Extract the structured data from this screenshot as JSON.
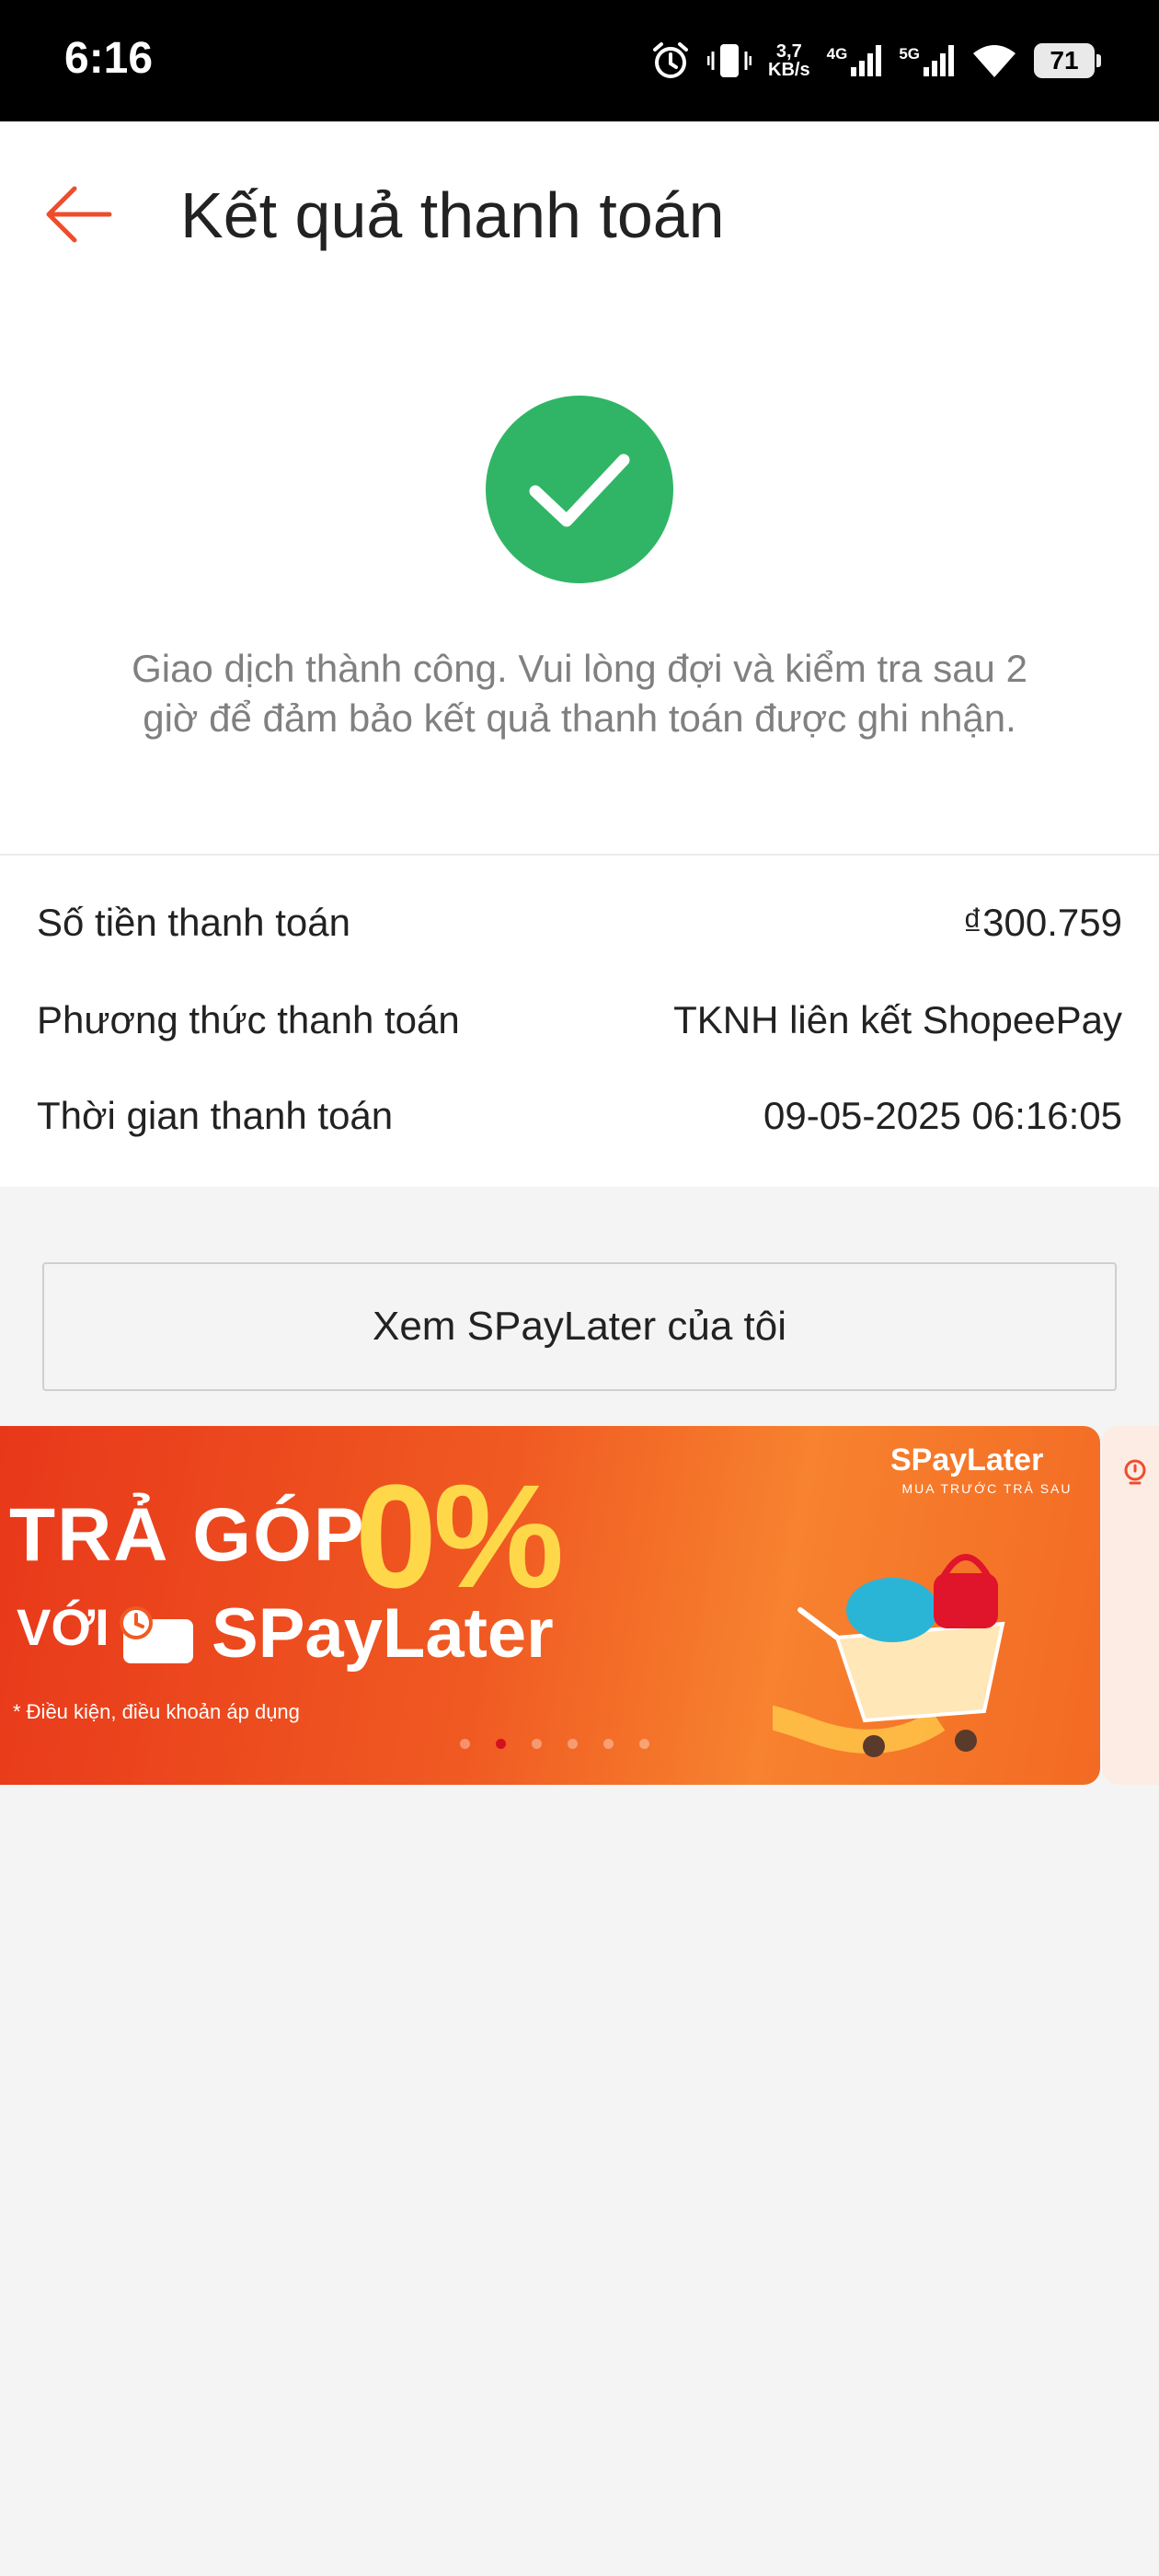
{
  "status_bar": {
    "time": "6:16",
    "net_speed_value": "3,7",
    "net_speed_unit": "KB/s",
    "network_4g": "4G",
    "network_5g": "5G",
    "battery": "71"
  },
  "header": {
    "title": "Kết quả thanh toán",
    "back_icon": "arrow-left-icon"
  },
  "result": {
    "icon": "check-icon",
    "message": "Giao dịch thành công. Vui lòng đợi và kiểm tra sau 2 giờ để đảm bảo kết quả thanh toán được ghi nhận."
  },
  "details": [
    {
      "label": "Số tiền thanh toán",
      "value": "₫300.759"
    },
    {
      "label": "Phương thức thanh toán",
      "value": "TKNH liên kết ShopeePay"
    },
    {
      "label": "Thời gian thanh toán",
      "value": "09-05-2025 06:16:05"
    }
  ],
  "cta_label": "Xem SPayLater của tôi",
  "banner": {
    "line1": "TRẢ GÓP",
    "percent": "0%",
    "line2": "VỚI",
    "brand": "SPayLater",
    "note": "* Điều kiện, điều khoản áp dụng",
    "logo": "SPayLater",
    "logo_sub": "MUA TRƯỚC TRẢ SAU",
    "slides": 6,
    "active_slide": 1
  },
  "colors": {
    "accent": "#ee4d2d",
    "success": "#30b566"
  }
}
